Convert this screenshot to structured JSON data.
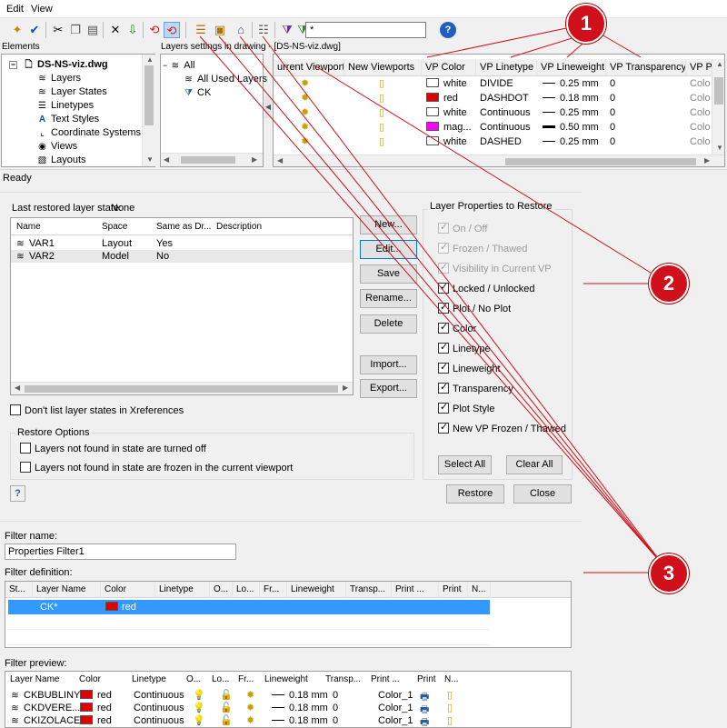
{
  "menu": [
    "Edit",
    "View"
  ],
  "toolbar": {
    "filter_value": "*"
  },
  "elements_panel": {
    "title": "Elements",
    "root": "DS-NS-viz.dwg",
    "items": [
      "Layers",
      "Layer States",
      "Linetypes",
      "Text Styles",
      "Coordinate Systems",
      "Views",
      "Layouts"
    ]
  },
  "layers_panel": {
    "title": "Layers settings in drawing - [DS-NS-viz.dwg]",
    "tree": [
      "All",
      "All Used Layers",
      "CK"
    ],
    "columns": [
      "urrent Viewport",
      "New Viewports",
      "VP Color",
      "VP Linetype",
      "VP Lineweight",
      "VP Transparency",
      "VP Pr"
    ],
    "rows": [
      {
        "color": "white",
        "color_hex": "#ffffff",
        "linetype": "DIVIDE",
        "lineweight": "0.25 mm",
        "transparency": "0",
        "plot": "Colo"
      },
      {
        "color": "red",
        "color_hex": "#e00000",
        "linetype": "DASHDOT",
        "lineweight": "0.18 mm",
        "transparency": "0",
        "plot": "Colo"
      },
      {
        "color": "white",
        "color_hex": "#ffffff",
        "linetype": "Continuous",
        "lineweight": "0.25 mm",
        "transparency": "0",
        "plot": "Colo"
      },
      {
        "color": "mag...",
        "color_hex": "#ff00ff",
        "linetype": "Continuous",
        "lineweight": "0.50 mm",
        "transparency": "0",
        "plot": "Colo"
      },
      {
        "color": "white",
        "color_hex": "#ffffff",
        "linetype": "DASHED",
        "lineweight": "0.25 mm",
        "transparency": "0",
        "plot": "Colo"
      }
    ]
  },
  "status": "Ready",
  "layer_states": {
    "last_restored_label": "Last restored layer state:",
    "last_restored_value": "None",
    "columns": [
      "Name",
      "Space",
      "Same as Dr...",
      "Description"
    ],
    "rows": [
      {
        "name": "VAR1",
        "space": "Layout",
        "same": "Yes"
      },
      {
        "name": "VAR2",
        "space": "Model",
        "same": "No"
      }
    ],
    "buttons": [
      "New...",
      "Edit...",
      "Save",
      "Rename...",
      "Delete",
      "Import...",
      "Export..."
    ],
    "dont_list": "Don't list layer states in Xreferences",
    "restore_options_title": "Restore Options",
    "restore_options": [
      "Layers not found in state are turned off",
      "Layers not found in state are frozen in the current viewport"
    ],
    "props_title": "Layer Properties to Restore",
    "props": [
      {
        "label": "On / Off",
        "checked": true,
        "disabled": true
      },
      {
        "label": "Frozen / Thawed",
        "checked": true,
        "disabled": true
      },
      {
        "label": "Visibility in Current VP",
        "checked": true,
        "disabled": true
      },
      {
        "label": "Locked / Unlocked",
        "checked": true,
        "disabled": false
      },
      {
        "label": "Plot / No Plot",
        "checked": true,
        "disabled": false
      },
      {
        "label": "Color",
        "checked": true,
        "disabled": false
      },
      {
        "label": "Linetype",
        "checked": true,
        "disabled": false
      },
      {
        "label": "Lineweight",
        "checked": true,
        "disabled": false
      },
      {
        "label": "Transparency",
        "checked": true,
        "disabled": false
      },
      {
        "label": "Plot Style",
        "checked": true,
        "disabled": false
      },
      {
        "label": "New VP Frozen / Thawed",
        "checked": true,
        "disabled": false
      }
    ],
    "select_all": "Select All",
    "clear_all": "Clear All",
    "help": "?",
    "restore": "Restore",
    "close": "Close"
  },
  "filter": {
    "name_label": "Filter name:",
    "name_value": "Properties Filter1",
    "definition_label": "Filter definition:",
    "def_columns": [
      "St...",
      "Layer Name",
      "Color",
      "Linetype",
      "O...",
      "Lo...",
      "Fr...",
      "Lineweight",
      "Transp...",
      "Print ...",
      "Print",
      "N..."
    ],
    "def_row": {
      "name": "CK*",
      "color": "red",
      "color_hex": "#e00000"
    },
    "preview_label": "Filter preview:",
    "prev_columns": [
      "Layer Name",
      "Color",
      "Linetype",
      "O...",
      "Lo...",
      "Fr...",
      "Lineweight",
      "Transp...",
      "Print ...",
      "Print",
      "N..."
    ],
    "prev_rows": [
      {
        "name": "CKBUBLINY",
        "color": "red",
        "linetype": "Continuous",
        "lineweight": "0.18 mm",
        "transp": "0",
        "plotstyle": "Color_1"
      },
      {
        "name": "CKDVERE...",
        "color": "red",
        "linetype": "Continuous",
        "lineweight": "0.18 mm",
        "transp": "0",
        "plotstyle": "Color_1"
      },
      {
        "name": "CKIZOLACE",
        "color": "red",
        "linetype": "Continuous",
        "lineweight": "0.18 mm",
        "transp": "0",
        "plotstyle": "Color_1"
      }
    ]
  },
  "callouts": [
    "1",
    "2",
    "3"
  ],
  "colors": {
    "callout": "#d0101a",
    "selection": "#3399ff"
  }
}
